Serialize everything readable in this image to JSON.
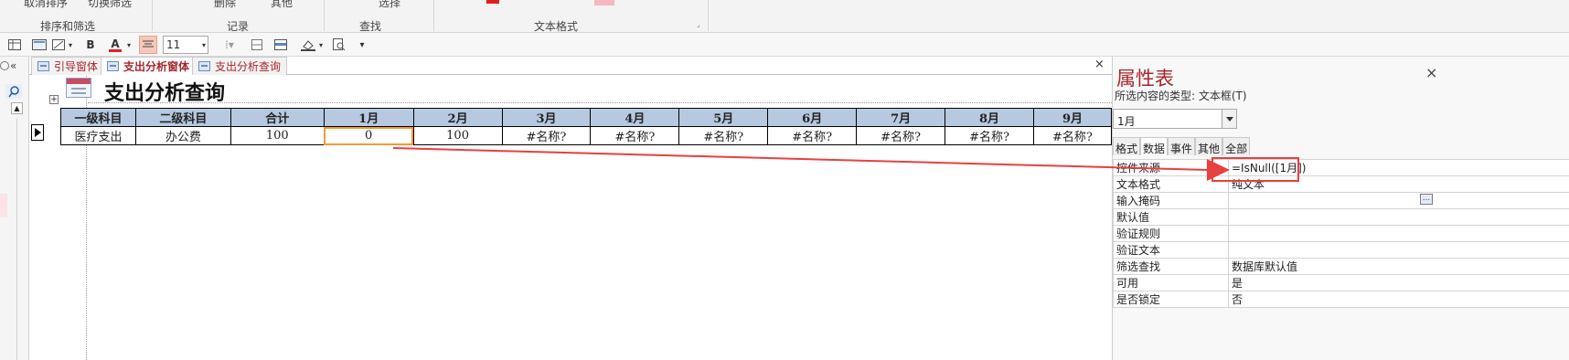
{
  "ribbon": {
    "sort_filter_row": [
      "取消排序",
      "切换筛选"
    ],
    "sort_filter_group": "排序和筛选",
    "records_row": [
      "删除",
      "其他"
    ],
    "records_group": "记录",
    "find_row": [
      "选择"
    ],
    "find_group": "查找",
    "text_format_group": "文本格式"
  },
  "format_bar": {
    "bold": "B",
    "font_color_letter": "A",
    "font_size": "11",
    "more": "▾"
  },
  "tabs": [
    {
      "label": "引导窗体",
      "active": false
    },
    {
      "label": "支出分析窗体",
      "active": true
    },
    {
      "label": "支出分析查询",
      "active": false
    }
  ],
  "tab_close": "×",
  "form": {
    "title": "支出分析查询",
    "expand": "+",
    "headers": [
      "一级科目",
      "二级科目",
      "合计",
      "1月",
      "2月",
      "3月",
      "4月",
      "5月",
      "6月",
      "7月",
      "8月",
      "9月"
    ],
    "row": [
      "医疗支出",
      "办公费",
      "100",
      "0",
      "100",
      "#名称?",
      "#名称?",
      "#名称?",
      "#名称?",
      "#名称?",
      "#名称?",
      "#名称?"
    ]
  },
  "property_sheet": {
    "title": "属性表",
    "close": "×",
    "selection_type_label": "所选内容的类型: 文本框(T)",
    "combo_value": "1月",
    "tabs": [
      "格式",
      "数据",
      "事件",
      "其他",
      "全部"
    ],
    "active_tab": "数据",
    "rows": [
      {
        "name": "控件来源",
        "value": "=IsNull([1月])"
      },
      {
        "name": "文本格式",
        "value": "纯文本"
      },
      {
        "name": "输入掩码",
        "value": ""
      },
      {
        "name": "默认值",
        "value": ""
      },
      {
        "name": "验证规则",
        "value": ""
      },
      {
        "name": "验证文本",
        "value": ""
      },
      {
        "name": "筛选查找",
        "value": "数据库默认值"
      },
      {
        "name": "可用",
        "value": "是"
      },
      {
        "name": "是否锁定",
        "value": "否"
      }
    ],
    "ellipsis": "..."
  },
  "annotation": {
    "color": "#e8403f"
  }
}
